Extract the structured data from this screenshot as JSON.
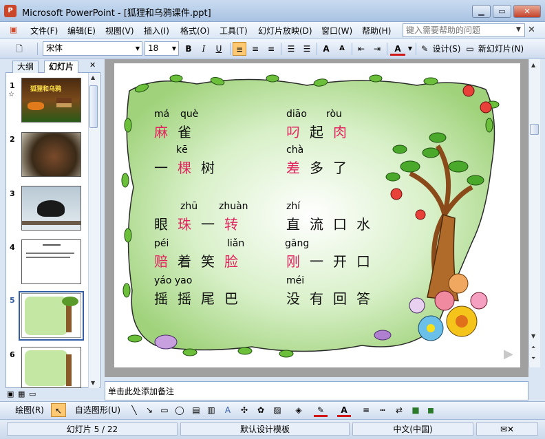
{
  "window": {
    "title": "Microsoft PowerPoint - [狐狸和乌鸦课件.ppt]",
    "icon": "powerpoint-icon"
  },
  "menu": {
    "items": [
      "文件(F)",
      "编辑(E)",
      "视图(V)",
      "插入(I)",
      "格式(O)",
      "工具(T)",
      "幻灯片放映(D)",
      "窗口(W)",
      "帮助(H)"
    ],
    "help_placeholder": "键入需要帮助的问题"
  },
  "toolbar": {
    "font": "宋体",
    "size": "18",
    "bold": "B",
    "italic": "I",
    "underline": "U",
    "design": "设计(S)",
    "new_slide": "新幻灯片(N)"
  },
  "leftpane": {
    "tabs": [
      "大纲",
      "幻灯片"
    ],
    "active_tab": "幻灯片",
    "slide_numbers": [
      "1",
      "2",
      "3",
      "4",
      "5",
      "6"
    ],
    "selected": "5",
    "thumb1_title": "狐狸和乌鸦"
  },
  "slide": {
    "rows": [
      {
        "left": {
          "pinyin": [
            "má",
            "què"
          ],
          "chars": [
            "麻",
            "雀"
          ],
          "red": [
            true,
            false
          ]
        },
        "right": {
          "pinyin": [
            "diāo",
            "ròu"
          ],
          "chars": [
            "叼",
            "起",
            "肉"
          ],
          "red": [
            true,
            false,
            true
          ]
        }
      },
      {
        "left": {
          "pinyin": [
            "kē"
          ],
          "chars": [
            "一",
            "棵",
            "树"
          ],
          "red": [
            false,
            true,
            false
          ]
        },
        "right": {
          "pinyin": [
            "chà"
          ],
          "chars": [
            "差",
            "多",
            "了"
          ],
          "red": [
            true,
            false,
            false
          ]
        }
      },
      {
        "left": {
          "pinyin": [
            "zhū",
            "zhuàn"
          ],
          "chars": [
            "眼",
            "珠",
            "一",
            "转"
          ],
          "red": [
            false,
            true,
            false,
            true
          ]
        },
        "right": {
          "pinyin": [
            "zhí"
          ],
          "chars": [
            "直",
            "流",
            "口",
            "水"
          ],
          "red": [
            false,
            false,
            false,
            false
          ]
        }
      },
      {
        "left": {
          "pinyin": [
            "péi",
            "liǎn"
          ],
          "chars": [
            "赔",
            "着",
            "笑",
            "脸"
          ],
          "red": [
            true,
            false,
            false,
            true
          ]
        },
        "right": {
          "pinyin": [
            "gāng"
          ],
          "chars": [
            "刚",
            "一",
            "开",
            "口"
          ],
          "red": [
            true,
            false,
            false,
            false
          ]
        }
      },
      {
        "left": {
          "pinyin": [
            "yáo yao"
          ],
          "chars": [
            "摇",
            "摇",
            "尾",
            "巴"
          ],
          "red": [
            false,
            false,
            false,
            false
          ]
        },
        "right": {
          "pinyin": [
            "méi"
          ],
          "chars": [
            "没",
            "有",
            "回",
            "答"
          ],
          "red": [
            false,
            false,
            false,
            false
          ]
        }
      }
    ]
  },
  "notes": {
    "placeholder": "单击此处添加备注"
  },
  "drawbar": {
    "draw": "绘图(R)",
    "autoshapes": "自选图形(U)"
  },
  "status": {
    "slide": "幻灯片 5 / 22",
    "template": "默认设计模板",
    "language": "中文(中国)"
  },
  "colors": {
    "highlight": "#e0245e",
    "accent": "#315ea5"
  }
}
